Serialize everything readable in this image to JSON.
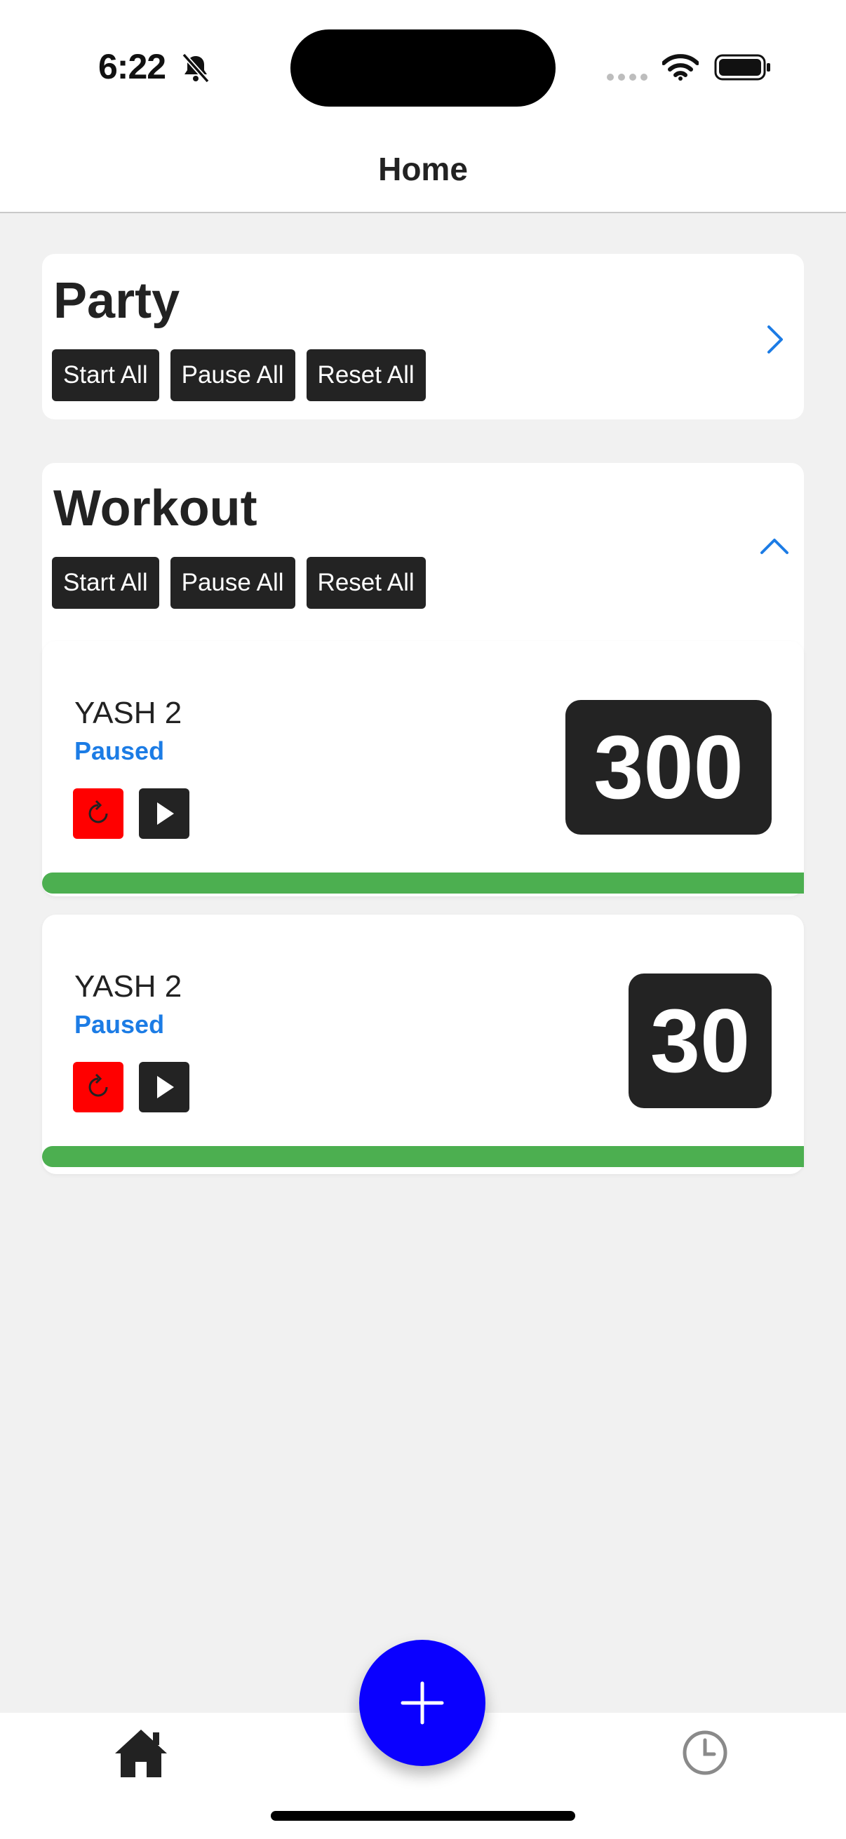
{
  "status_bar": {
    "time": "6:22"
  },
  "header": {
    "title": "Home"
  },
  "groups": [
    {
      "title": "Party",
      "buttons": {
        "start": "Start All",
        "pause": "Pause All",
        "reset": "Reset All"
      },
      "expanded": false
    },
    {
      "title": "Workout",
      "buttons": {
        "start": "Start All",
        "pause": "Pause All",
        "reset": "Reset All"
      },
      "expanded": true,
      "timers": [
        {
          "name": "YASH 2",
          "status": "Paused",
          "remaining": "300",
          "progress": 1.0
        },
        {
          "name": "YASH 2",
          "status": "Paused",
          "remaining": "30",
          "progress": 1.0
        }
      ]
    }
  ],
  "tab_bar": {
    "tabs": [
      {
        "icon": "home-icon"
      },
      {
        "icon": "clock-icon"
      }
    ],
    "fab_icon": "plus-icon"
  },
  "colors": {
    "accent": "#1c7ce5",
    "fab": "#0a00ff",
    "progress": "#4caf50",
    "reset": "#ff0000",
    "dark": "#232323"
  }
}
